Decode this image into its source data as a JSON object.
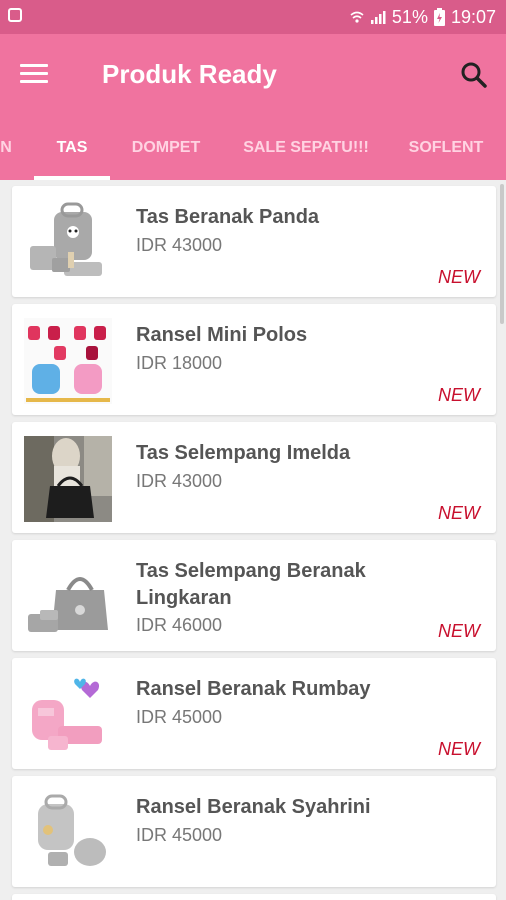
{
  "status_bar": {
    "battery": "51%",
    "time": "19:07"
  },
  "app_bar": {
    "title": "Produk Ready",
    "menu_icon": "hamburger-menu-icon",
    "search_icon": "search-icon"
  },
  "tabs": [
    {
      "label": "N",
      "active": false
    },
    {
      "label": "TAS",
      "active": true
    },
    {
      "label": "DOMPET",
      "active": false
    },
    {
      "label": "SALE SEPATU!!!",
      "active": false
    },
    {
      "label": "SOFLENT",
      "active": false
    }
  ],
  "products": [
    {
      "name": "Tas Beranak Panda",
      "price": "IDR 43000",
      "badge": "NEW"
    },
    {
      "name": "Ransel Mini Polos",
      "price": "IDR 18000",
      "badge": "NEW"
    },
    {
      "name": "Tas Selempang Imelda",
      "price": "IDR 43000",
      "badge": "NEW"
    },
    {
      "name": "Tas Selempang Beranak Lingkaran",
      "price": "IDR 46000",
      "badge": "NEW"
    },
    {
      "name": "Ransel Beranak Rumbay",
      "price": "IDR 45000",
      "badge": "NEW"
    },
    {
      "name": "Ransel Beranak Syahrini",
      "price": "IDR 45000",
      "badge": ""
    }
  ],
  "colors": {
    "status_bar": "#d95c8a",
    "app_bar": "#f0739f",
    "badge": "#c8102e"
  }
}
